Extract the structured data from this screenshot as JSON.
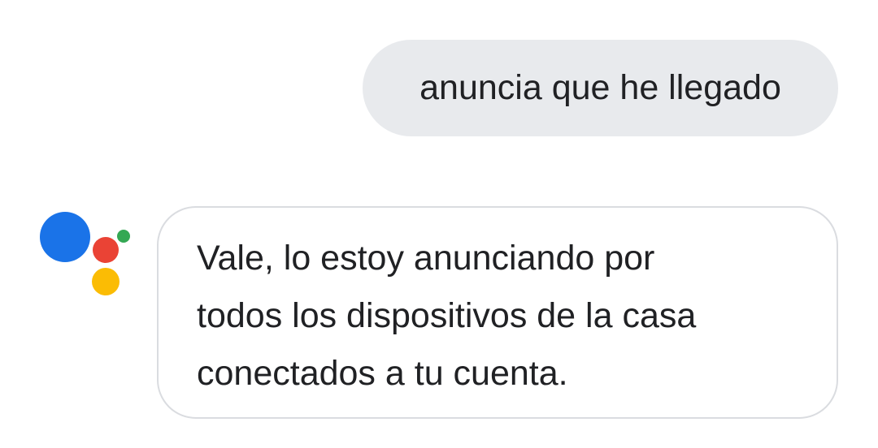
{
  "conversation": {
    "user_message": "anuncia que he llegado",
    "assistant_message": {
      "lines": [
        "Vale, lo estoy anunciando por",
        "todos los dispositivos de la casa",
        "conectados a tu cuenta."
      ]
    }
  },
  "assistant_logo": {
    "icon": "google-assistant-icon",
    "colors": {
      "blue": "#1a73e8",
      "red": "#ea4335",
      "yellow": "#fbbc04",
      "green": "#34a853"
    }
  },
  "colors": {
    "user_bubble_bg": "#e8eaed",
    "assistant_bubble_border": "#dadce0",
    "text": "#202124"
  }
}
